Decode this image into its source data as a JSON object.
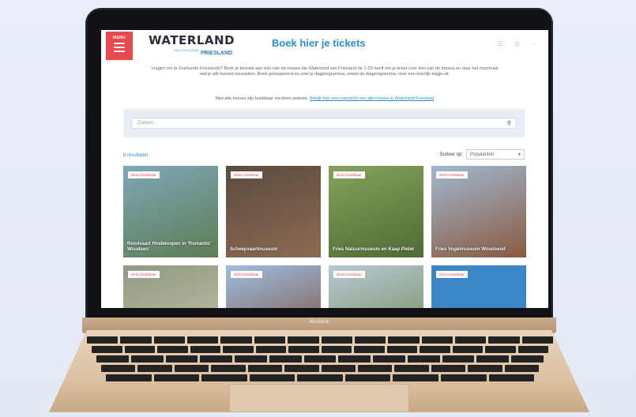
{
  "brand_colors": {
    "accent": "#e84a4e",
    "link": "#2e8fd4"
  },
  "laptop": {
    "brand": "MacBook"
  },
  "header": {
    "menu_label": "MENU",
    "logo_text": "WATERLAND",
    "logo_tagline": "VAN FRIESLAND",
    "logo_sub": "FRIESLAND",
    "title": "Boek hier je tickets",
    "icons": [
      "user-icon",
      "globe-icon",
      "language-icon"
    ]
  },
  "intro": {
    "text": "Vragen om te Zeehonde Frieslands? Boek je bezoek aan één van de musea die Waterland van Friesland de 1-29 heeft om je ticket voor één van de musea en daar het maximaal wat je wilt kunnen bezoeken. Boek geïnspireerd en snel je dagprogramma, zowel de dagprogramma, voor een heerlijk dagje uit.",
    "more_prefix": "Niet alle musea zijn boekbaar via deze website.",
    "more_link": "Bekijk hier een overzicht van alle musea in Waterland Friesland"
  },
  "search": {
    "placeholder": "Zoeken"
  },
  "results": {
    "count_label": "8 resultaten",
    "sort_label": "Sorteer op:",
    "sort_value": "Populariteit"
  },
  "cards": [
    {
      "tag": "Direct boekbaar",
      "caption": "Rondvaart Hindeloopen in 'Romantic' Woudsen",
      "c1": "#7fa7b8",
      "c2": "#5c7d54"
    },
    {
      "tag": "Direct boekbaar",
      "caption": "Scheepvaartmuseum",
      "c1": "#5a4b3f",
      "c2": "#8e6a52"
    },
    {
      "tag": "Direct boekbaar",
      "caption": "Fries Natuurmuseum en Kaap Pieter",
      "c1": "#87a15c",
      "c2": "#4f6b35"
    },
    {
      "tag": "Direct boekbaar",
      "caption": "Fries Vogelmuseum Woudsend",
      "c1": "#9fb9d1",
      "c2": "#8a5a40"
    },
    {
      "tag": "Direct boekbaar",
      "caption": "",
      "c1": "#8f9a84",
      "c2": "#c9c2a6"
    },
    {
      "tag": "Direct boekbaar",
      "caption": "",
      "c1": "#9dbfe0",
      "c2": "#7c4a36"
    },
    {
      "tag": "Direct boekbaar",
      "caption": "",
      "c1": "#b7c9d8",
      "c2": "#6e8a4c"
    },
    {
      "tag": "Direct boekbaar",
      "caption": "",
      "c1": "#3d86c6",
      "c2": "#3d86c6"
    }
  ]
}
